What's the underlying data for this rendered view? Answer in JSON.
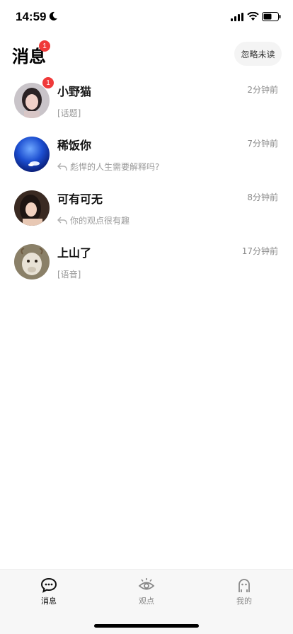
{
  "status_bar": {
    "time": "14:59",
    "icons": [
      "moon-icon",
      "signal-icon",
      "wifi-icon",
      "battery-icon"
    ]
  },
  "header": {
    "title": "消息",
    "badge_count": "1",
    "ignore_unread_label": "忽略未读"
  },
  "messages": [
    {
      "name": "小野猫",
      "time": "2分钟前",
      "preview": "[话题]",
      "is_reply": false,
      "badge": "1",
      "avatar": "avatar-girl-photo"
    },
    {
      "name": "稀饭你",
      "time": "7分钟前",
      "preview": "彪悍的人生需要解释吗?",
      "is_reply": true,
      "badge": "",
      "avatar": "avatar-blue-sphere"
    },
    {
      "name": "可有可无",
      "time": "8分钟前",
      "preview": "你的观点很有趣",
      "is_reply": true,
      "badge": "",
      "avatar": "avatar-woman-photo"
    },
    {
      "name": "上山了",
      "time": "17分钟前",
      "preview": "[语音]",
      "is_reply": false,
      "badge": "",
      "avatar": "avatar-goat-photo"
    }
  ],
  "tab_bar": {
    "tabs": [
      {
        "label": "消息",
        "icon": "chat-bubble-icon",
        "active": true
      },
      {
        "label": "观点",
        "icon": "eye-icon",
        "active": false
      },
      {
        "label": "我的",
        "icon": "robot-face-icon",
        "active": false
      }
    ]
  },
  "colors": {
    "badge": "#f03a3a",
    "muted_text": "#9a9a9a",
    "tab_bar_bg": "#f7f7f7"
  }
}
